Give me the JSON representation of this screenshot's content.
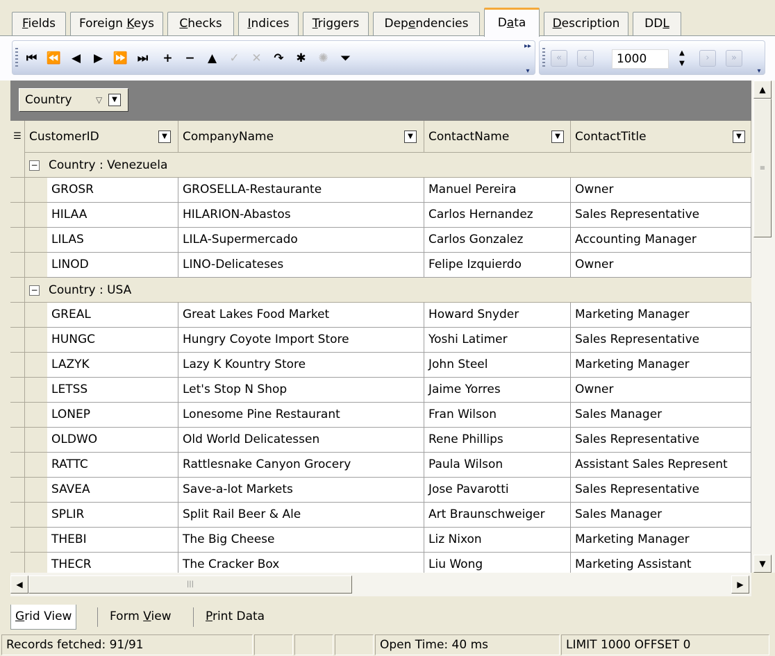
{
  "tabs": [
    {
      "pre": "",
      "u": "F",
      "post": "ields"
    },
    {
      "pre": "Foreign ",
      "u": "K",
      "post": "eys"
    },
    {
      "pre": "",
      "u": "C",
      "post": "hecks"
    },
    {
      "pre": "",
      "u": "I",
      "post": "ndices"
    },
    {
      "pre": "",
      "u": "T",
      "post": "riggers"
    },
    {
      "pre": "Dep",
      "u": "e",
      "post": "ndencies"
    },
    {
      "pre": "D",
      "u": "a",
      "post": "ta"
    },
    {
      "pre": "",
      "u": "D",
      "post": "escription"
    },
    {
      "pre": "DD",
      "u": "L",
      "post": ""
    }
  ],
  "active_tab": 6,
  "toolbar": {
    "nav_icons": [
      "first-record-icon",
      "prior-page-icon",
      "prior-record-icon",
      "next-record-icon",
      "next-page-icon",
      "last-record-icon",
      "insert-icon",
      "delete-icon",
      "edit-icon",
      "post-icon",
      "cancel-icon",
      "refresh-icon",
      "save-bookmark-icon",
      "goto-bookmark-icon",
      "filter-icon"
    ],
    "nav_glyphs": [
      "⏮",
      "⏪",
      "◀",
      "▶",
      "⏩",
      "⏭",
      "+",
      "−",
      "▲",
      "✓",
      "✕",
      "↷",
      "✱",
      "✺",
      "⏷"
    ],
    "nav_disabled": [
      false,
      false,
      false,
      false,
      false,
      false,
      false,
      false,
      false,
      true,
      true,
      false,
      false,
      true,
      false
    ],
    "limit_value": "1000"
  },
  "group_panel": {
    "chip_label": "Country"
  },
  "columns": [
    "CustomerID",
    "CompanyName",
    "ContactName",
    "ContactTitle"
  ],
  "groups": [
    {
      "label": "Country : Venezuela",
      "rows": [
        [
          "GROSR",
          "GROSELLA-Restaurante",
          "Manuel Pereira",
          "Owner"
        ],
        [
          "HILAA",
          "HILARION-Abastos",
          "Carlos Hernandez",
          "Sales Representative"
        ],
        [
          "LILAS",
          "LILA-Supermercado",
          "Carlos Gonzalez",
          "Accounting Manager"
        ],
        [
          "LINOD",
          "LINO-Delicateses",
          "Felipe Izquierdo",
          "Owner"
        ]
      ]
    },
    {
      "label": "Country : USA",
      "rows": [
        [
          "GREAL",
          "Great Lakes Food Market",
          "Howard Snyder",
          "Marketing Manager"
        ],
        [
          "HUNGC",
          "Hungry Coyote Import Store",
          "Yoshi Latimer",
          "Sales Representative"
        ],
        [
          "LAZYK",
          "Lazy K Kountry Store",
          "John Steel",
          "Marketing Manager"
        ],
        [
          "LETSS",
          "Let's Stop N Shop",
          "Jaime Yorres",
          "Owner"
        ],
        [
          "LONEP",
          "Lonesome Pine Restaurant",
          "Fran Wilson",
          "Sales Manager"
        ],
        [
          "OLDWO",
          "Old World Delicatessen",
          "Rene Phillips",
          "Sales Representative"
        ],
        [
          "RATTC",
          "Rattlesnake Canyon Grocery",
          "Paula Wilson",
          "Assistant Sales Represent"
        ],
        [
          "SAVEA",
          "Save-a-lot Markets",
          "Jose Pavarotti",
          "Sales Representative"
        ],
        [
          "SPLIR",
          "Split Rail Beer & Ale",
          "Art Braunschweiger",
          "Sales Manager"
        ],
        [
          "THEBI",
          "The Big Cheese",
          "Liz Nixon",
          "Marketing Manager"
        ],
        [
          "THECR",
          "The Cracker Box",
          "Liu Wong",
          "Marketing Assistant"
        ]
      ]
    }
  ],
  "view_tabs": [
    {
      "u": "G",
      "post": "rid View",
      "pre": ""
    },
    {
      "pre": "Form ",
      "u": "V",
      "post": "iew"
    },
    {
      "pre": "",
      "u": "P",
      "post": "rint Data"
    }
  ],
  "status": {
    "records": "Records fetched: 91/91",
    "open_time": "Open Time: 40 ms",
    "limit": "LIMIT 1000 OFFSET 0"
  }
}
